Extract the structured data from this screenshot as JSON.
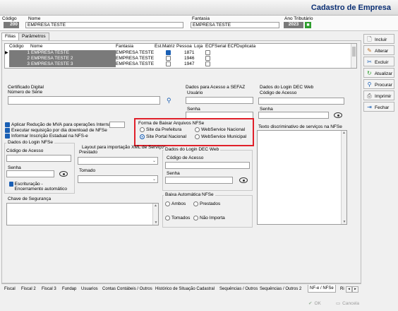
{
  "window": {
    "title": "Cadastro de Empresa"
  },
  "header": {
    "codigo_label": "Código",
    "codigo_value": "200",
    "nome_label": "Nome",
    "nome_value": "EMPRESA TESTE",
    "fantasia_label": "Fantasia",
    "fantasia_value": "EMPRESA TESTE",
    "ano_label": "Ano Tributário",
    "ano_value": "2023"
  },
  "top_tabs": [
    "Filias",
    "Parâmetros"
  ],
  "grid": {
    "columns": [
      "Código",
      "Nome",
      "Fantasia",
      "Est.",
      "Matriz",
      "Pessoa",
      "Loja",
      "ECF",
      "Serial ECF",
      "Duplicata"
    ],
    "rows": [
      {
        "codigo": "1",
        "nome": "EMPRESA TESTE",
        "fantasia": "EMPRESA TESTE",
        "matriz": true,
        "pessoa": "1871",
        "ecf": false
      },
      {
        "codigo": "2",
        "nome": "EMPRESA TESTE 2",
        "fantasia": "EMPRESA TESTE",
        "matriz": false,
        "pessoa": "1946",
        "ecf": false
      },
      {
        "codigo": "3",
        "nome": "EMPRESA TESTE 3",
        "fantasia": "EMPRESA TESTE",
        "matriz": false,
        "pessoa": "1947",
        "ecf": false
      }
    ]
  },
  "buttons": {
    "incluir": "Incluir",
    "alterar": "Alterar",
    "excluir": "Excluir",
    "atualizar": "Atualizar",
    "procurar": "Procurar",
    "imprimir": "Imprimir",
    "fechar": "Fechar"
  },
  "cert": {
    "title": "Certificado Digital",
    "serie_label": "Número de Série"
  },
  "sefaz": {
    "title": "Dados para Acesso a SEFAZ",
    "usuario": "Usuário",
    "senha": "Senha"
  },
  "login_dec_top": {
    "title": "Dados do Login DEC Web",
    "codigo": "Código de Acesso",
    "senha": "Senha"
  },
  "options": {
    "mva": "Aplicar Redução de MVA para operações Internas",
    "download": "Executar requisição por dia download de NFSe",
    "inscricao": "Informar Inscrição Estadual na NFS-e"
  },
  "forma": {
    "title": "Forma de Baixar Arquivos NFSe",
    "site_prefeitura": "Site da Prefeitura",
    "ws_nacional": "WebService Nacional",
    "site_portal": "Site Portal Nacional",
    "ws_municipal": "WebService Municipal"
  },
  "texto_discriminativo": "Texto discriminativo de serviços na NFSe",
  "login_nfse": {
    "title": "Dados do Login NFSe",
    "codigo": "Código de Acesso",
    "senha": "Senha",
    "escrituracao": "Escrituração - Encerramento automático"
  },
  "layout_xml": {
    "title": "Layout para importação XML de Serviços",
    "prestado": "Prestado",
    "tomado": "Tomado"
  },
  "login_dec_mid": {
    "title": "Dados do Login DEC Web",
    "codigo": "Código de Acesso",
    "senha": "Senha"
  },
  "baixa_auto": {
    "title": "Baixa Automática NFSe",
    "ambos": "Ambos",
    "prestados": "Prestados",
    "tomados": "Tomados",
    "nao_importa": "Não Importa"
  },
  "chave": {
    "label": "Chave de Segurança"
  },
  "bottom_tabs": [
    "Fiscal",
    "Fiscal 2",
    "Fiscal 3",
    "Fundap",
    "Usuarios",
    "Contas Contábeis / Outros",
    "Histórico de Situação Cadastral",
    "Sequências / Outros",
    "Sequências / Outros 2",
    "NF-e / NFSe",
    "Ri"
  ],
  "footer": {
    "ok": "OK",
    "cancela": "Cancela"
  },
  "colors": {
    "accent": "#1a5fb4",
    "highlight": "#e0202a",
    "title": "#0b2f74",
    "ano_icon": "#2e9d2e",
    "row_selected": "#7a7a7a"
  }
}
